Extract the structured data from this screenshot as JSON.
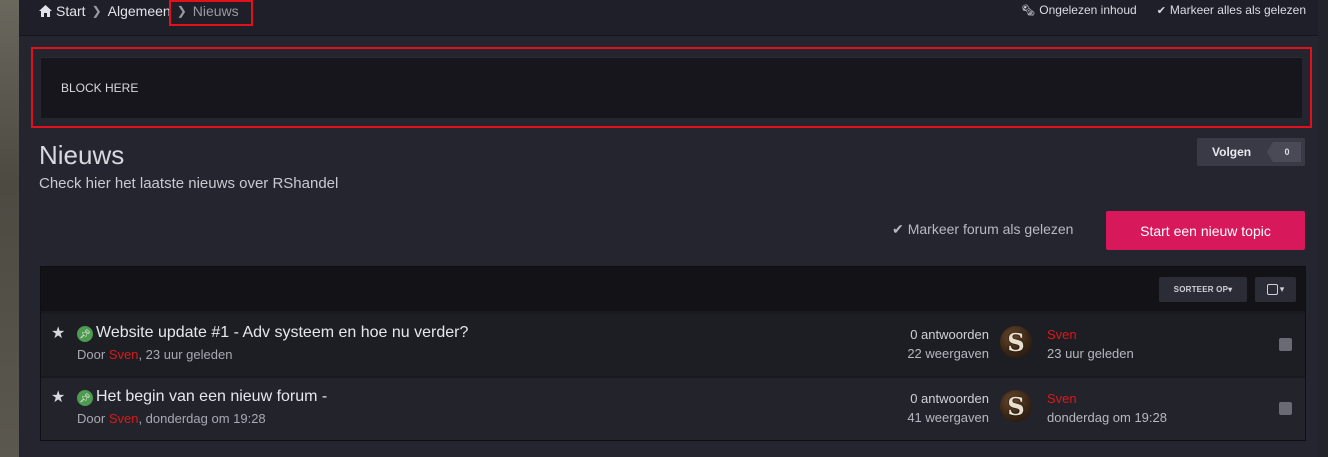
{
  "breadcrumb": {
    "items": [
      "Start",
      "Algemeen",
      "Nieuws"
    ]
  },
  "top_actions": {
    "unread": "Ongelezen inhoud",
    "mark_all": "Markeer alles als gelezen"
  },
  "block": {
    "text": "BLOCK HERE"
  },
  "header": {
    "title": "Nieuws",
    "description": "Check hier het laatste nieuws over RShandel",
    "follow_label": "Volgen",
    "follow_count": "0",
    "mark_forum_read": "Markeer forum als gelezen",
    "new_topic": "Start een nieuw topic"
  },
  "list": {
    "sort_label": "SORTEER OP",
    "topics": [
      {
        "title": "Website update #1 - Adv systeem en hoe nu verder?",
        "by": "Door",
        "author": "Sven",
        "started": ", 23 uur geleden",
        "replies": "0 antwoorden",
        "views": "22 weergaven",
        "avatar_letter": "S",
        "last_author": "Sven",
        "last_time": "23 uur geleden"
      },
      {
        "title": "Het begin van een nieuw forum -",
        "by": "Door",
        "author": "Sven",
        "started": ", donderdag om 19:28",
        "replies": "0 antwoorden",
        "views": "41 weergaven",
        "avatar_letter": "S",
        "last_author": "Sven",
        "last_time": "donderdag om 19:28"
      }
    ]
  },
  "colors": {
    "accent": "#d7185a",
    "highlight_border": "#e0101c",
    "author_red": "#d81b1b"
  }
}
